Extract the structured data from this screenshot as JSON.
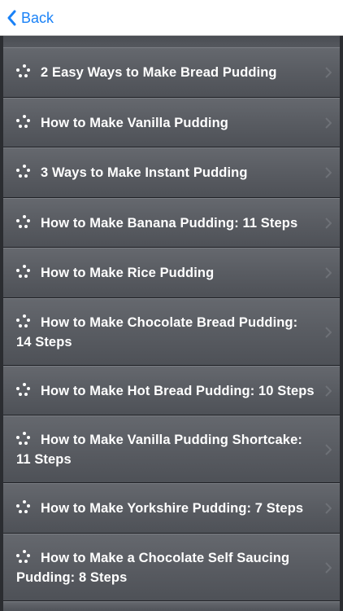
{
  "navbar": {
    "back_label": "Back"
  },
  "items": [
    {
      "label": "2 Easy Ways to Make Bread Pudding"
    },
    {
      "label": "How to Make Vanilla Pudding"
    },
    {
      "label": "3 Ways to Make Instant Pudding"
    },
    {
      "label": "How to Make Banana Pudding: 11 Steps"
    },
    {
      "label": "How to Make Rice Pudding"
    },
    {
      "label": "How to Make Chocolate Bread Pudding: 14 Steps"
    },
    {
      "label": "How to Make Hot Bread Pudding: 10 Steps"
    },
    {
      "label": "How to Make Vanilla Pudding Shortcake: 11 Steps"
    },
    {
      "label": "How to Make Yorkshire Pudding: 7 Steps"
    },
    {
      "label": "How to Make a Chocolate Self Saucing Pudding: 8 Steps"
    }
  ],
  "colors": {
    "accent": "#1a82f7",
    "row_top": "#65686e",
    "row_bottom": "#4e5157",
    "background": "#2b2d31"
  },
  "icons": {
    "back": "chevron-left-icon",
    "row_bullet": "dots-icon",
    "row_disclosure": "chevron-right-icon"
  }
}
